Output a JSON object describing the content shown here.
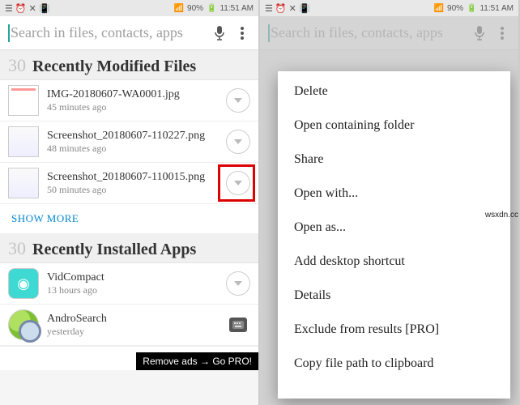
{
  "status": {
    "network_icons": "◎",
    "wifi": true,
    "battery_text": "90%",
    "time": "11:51 AM",
    "alarm": "⏰",
    "vibrate": "📳"
  },
  "search": {
    "placeholder": "Search in files, contacts, apps"
  },
  "sections": {
    "files": {
      "count": "30",
      "title": "Recently Modified Files",
      "items": [
        {
          "name": "IMG-20180607-WA0001.jpg",
          "time": "45 minutes ago"
        },
        {
          "name": "Screenshot_20180607-110227.png",
          "time": "48 minutes ago"
        },
        {
          "name": "Screenshot_20180607-110015.png",
          "time": "50 minutes ago"
        }
      ],
      "show_more": "SHOW MORE"
    },
    "apps": {
      "count": "30",
      "title": "Recently Installed Apps",
      "items": [
        {
          "name": "VidCompact",
          "time": "13 hours ago"
        },
        {
          "name": "AndroSearch",
          "time": "yesterday"
        }
      ]
    }
  },
  "ad": {
    "text": "Remove ads → Go PRO!"
  },
  "context_menu": {
    "items": [
      "Delete",
      "Open containing folder",
      "Share",
      "Open with...",
      "Open as...",
      "Add desktop shortcut",
      "Details",
      "Exclude from results [PRO]",
      "Copy file path to clipboard"
    ]
  },
  "watermark": "wsxdn.cc"
}
